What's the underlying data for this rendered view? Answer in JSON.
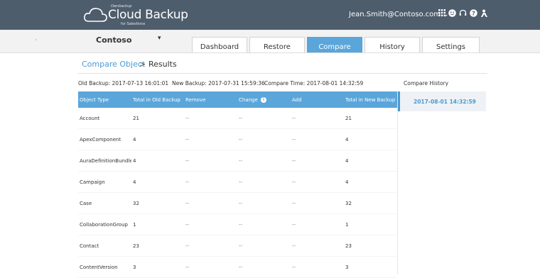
{
  "header": {
    "brand_small": "Ownbackup",
    "brand_name": "Cloud Backup",
    "brand_sub": "for Salesforce",
    "user": "Jean.Smith@Contoso.com",
    "user_caret": "⌄",
    "icons": [
      "apps-grid-icon",
      "smile-icon",
      "headset-icon",
      "help-icon",
      "user-settings-icon"
    ]
  },
  "org": {
    "name": "Contoso",
    "caret": "▾",
    "dot": "·"
  },
  "tabs": [
    {
      "label": "Dashboard",
      "active": false
    },
    {
      "label": "Restore",
      "active": false
    },
    {
      "label": "Compare",
      "active": true
    },
    {
      "label": "History",
      "active": false
    },
    {
      "label": "Settings",
      "active": false
    }
  ],
  "breadcrumb": {
    "link": "Compare Object",
    "sep": ">",
    "current": "Results"
  },
  "meta": {
    "old_backup": "Old Backup: 2017-07-13 16:01:01",
    "new_backup": "New Backup: 2017-07-31 15:59:36",
    "compare_time": "Compare Time: 2017-08-01 14:32:59"
  },
  "table": {
    "headers": [
      "Object Type",
      "Total in Old Backup",
      "Remove",
      "Change",
      "Add",
      "Total in New Backup"
    ],
    "info_icon": "i",
    "rows": [
      [
        "Account",
        "21",
        "--",
        "--",
        "--",
        "21"
      ],
      [
        "ApexComponent",
        "4",
        "--",
        "--",
        "--",
        "4"
      ],
      [
        "AuraDefinitionBundle",
        "4",
        "--",
        "--",
        "--",
        "4"
      ],
      [
        "Campaign",
        "4",
        "--",
        "--",
        "--",
        "4"
      ],
      [
        "Case",
        "32",
        "--",
        "--",
        "--",
        "32"
      ],
      [
        "CollaborationGroup",
        "1",
        "--",
        "--",
        "--",
        "1"
      ],
      [
        "Contact",
        "23",
        "--",
        "--",
        "--",
        "23"
      ],
      [
        "ContentVersion",
        "3",
        "--",
        "--",
        "--",
        "3"
      ]
    ]
  },
  "compare_history": {
    "title": "Compare History",
    "items": [
      "2017-08-01 14:32:59"
    ]
  },
  "colors": {
    "header_bg": "#4e5d6c",
    "accent": "#5aa6da",
    "link": "#4a9ad3"
  }
}
